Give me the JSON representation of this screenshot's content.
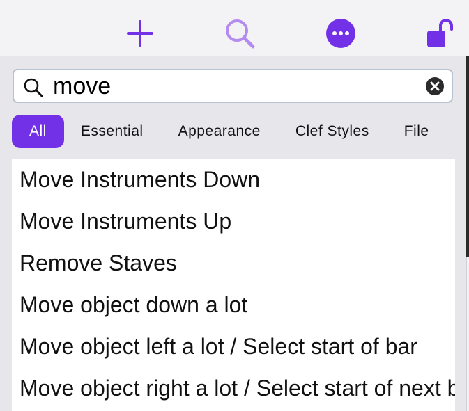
{
  "colors": {
    "accent": "#7231e6",
    "accent_light": "#b48cf0",
    "panel_bg": "#e6e6eb"
  },
  "toolbar": {
    "buttons": [
      {
        "icon": "plus-icon"
      },
      {
        "icon": "search-icon"
      },
      {
        "icon": "more-icon"
      },
      {
        "icon": "unlock-icon"
      }
    ]
  },
  "search": {
    "value": "move",
    "icon": "magnifier-icon",
    "clear_icon": "clear-icon"
  },
  "categories": [
    {
      "label": "All",
      "active": true
    },
    {
      "label": "Essential",
      "active": false
    },
    {
      "label": "Appearance",
      "active": false
    },
    {
      "label": "Clef Styles",
      "active": false
    },
    {
      "label": "File",
      "active": false
    }
  ],
  "results": [
    "Move Instruments Down",
    "Move Instruments Up",
    "Remove Staves",
    "Move object down a lot",
    "Move object left a lot / Select start of bar",
    "Move object right a lot / Select start of next bar"
  ]
}
